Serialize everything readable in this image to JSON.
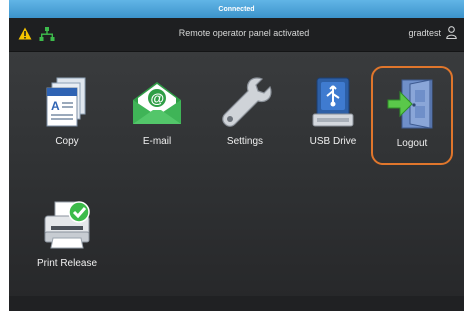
{
  "status_bar": {
    "text": "Connected"
  },
  "top_bar": {
    "message": "Remote operator panel activated",
    "username": "gradtest",
    "icons": [
      "warning-icon",
      "network-icon",
      "user-icon"
    ]
  },
  "apps": [
    {
      "label": "Copy",
      "icon": "copy-icon"
    },
    {
      "label": "E-mail",
      "icon": "email-icon"
    },
    {
      "label": "Settings",
      "icon": "settings-icon"
    },
    {
      "label": "USB Drive",
      "icon": "usb-drive-icon"
    },
    {
      "label": "Logout",
      "icon": "logout-icon",
      "highlighted": true
    },
    {
      "label": "Print Release",
      "icon": "print-release-icon"
    }
  ],
  "colors": {
    "status_bar": "#4aa6dc",
    "highlight": "#e0762c",
    "warning": "#f5c400",
    "network": "#3dbb4c"
  }
}
